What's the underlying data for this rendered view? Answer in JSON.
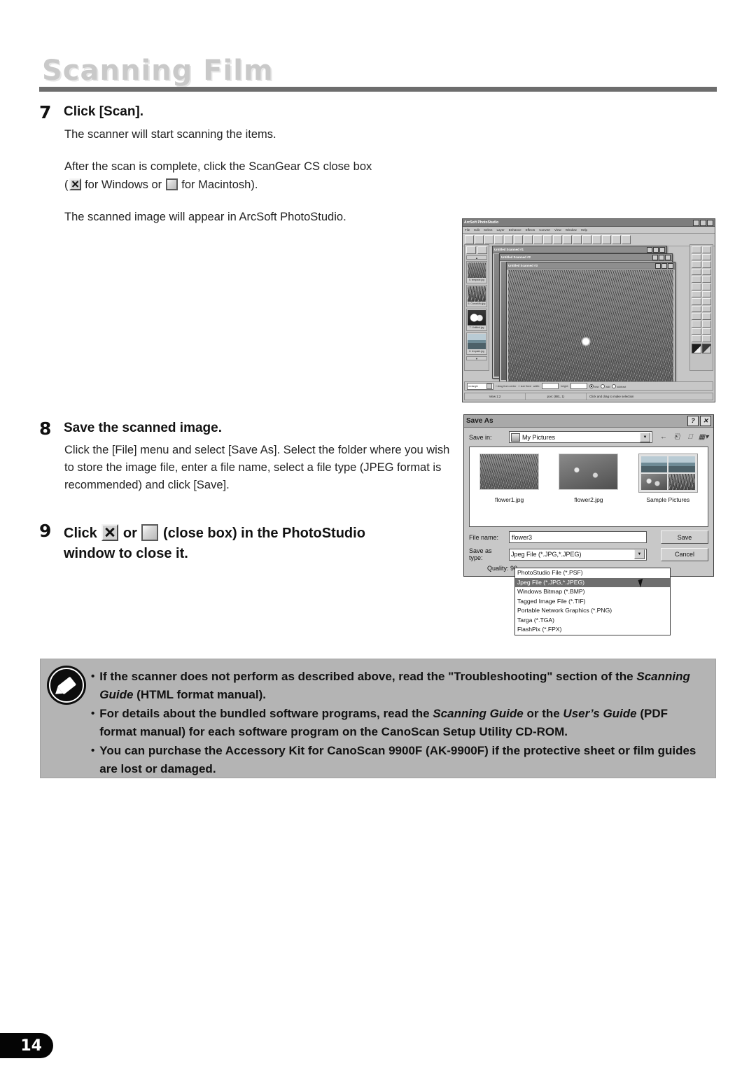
{
  "header": {
    "chapter_title": "Scanning Film"
  },
  "steps": [
    {
      "number": "7",
      "heading": "Click [Scan].",
      "line1": "The scanner will start scanning the items.",
      "line2": "After the scan is complete, click the ScanGear CS close box",
      "line3_open": "(",
      "line3_mid": " for Windows or ",
      "line3_end": " for Macintosh).",
      "line4": "The scanned image will appear in ArcSoft PhotoStudio."
    },
    {
      "number": "8",
      "heading": "Save the scanned image.",
      "body": "Click the [File] menu and select [Save As]. Select the folder where you wish to store the image file, enter a file name, select a file type (JPEG format is recommended) and click [Save]."
    },
    {
      "number": "9",
      "heading_a": "Click ",
      "heading_b": " or ",
      "heading_c": " (close box) in the PhotoStudio",
      "heading_d": "window to close it."
    }
  ],
  "photostudio": {
    "app_title": "ArcSoft PhotoStudio",
    "menus": [
      "File",
      "Edit",
      "Select",
      "Layer",
      "Enhance",
      "Effects",
      "Convert",
      "View",
      "Window",
      "Help"
    ],
    "album_thumbs": [
      {
        "caption": "5. tempwie.jpg"
      },
      {
        "caption": "6. CanonMio.jpg"
      },
      {
        "caption": "7. Untitled.jpg"
      },
      {
        "caption": "8. tenpaint.jpg"
      }
    ],
    "doc_windows": [
      {
        "title": "Untitled Scanned #1"
      },
      {
        "title": "Untitled Scanned #2"
      },
      {
        "title": "Untitled Scanned #3"
      }
    ],
    "option_bar": {
      "shape": "rectangle",
      "opt1": "drag from center",
      "opt2": "size fixed",
      "width_label": "width:",
      "height_label": "height:",
      "radio_new": "new",
      "radio_add": "add",
      "radio_subtract": "subtract"
    },
    "status": {
      "view": "View 1:2",
      "pos": "pos: (881, 1)",
      "hint": "Click and drag to make selection"
    }
  },
  "save_as": {
    "title": "Save As",
    "help_glyph": "?",
    "close_glyph": "✕",
    "save_in_label": "Save in:",
    "save_in_value": "My Pictures",
    "nav_icons": [
      "back-arrow-icon",
      "up-one-level-icon",
      "new-folder-icon",
      "views-icon"
    ],
    "files": [
      {
        "name": "flower1.jpg",
        "type": "image"
      },
      {
        "name": "flower2.jpg",
        "type": "image"
      },
      {
        "name": "Sample Pictures",
        "type": "folder"
      }
    ],
    "file_name_label": "File name:",
    "file_name_value": "flower3",
    "save_as_type_label": "Save as type:",
    "save_as_type_value": "Jpeg File (*.JPG,*.JPEG)",
    "quality_label": "Quality: 90",
    "save_button": "Save",
    "cancel_button": "Cancel",
    "type_options": [
      "PhotoStudio File (*.PSF)",
      "Jpeg File (*.JPG,*.JPEG)",
      "Windows Bitmap (*.BMP)",
      "Tagged Image File (*.TIF)",
      "Portable Network Graphics (*.PNG)",
      "Targa (*.TGA)",
      "FlashPix (*.FPX)"
    ],
    "selected_option_index": 1
  },
  "notes": [
    {
      "p1": "If the scanner does not perform as described above, read the \"Troubleshooting\" section of the ",
      "em1": "Scanning Guide",
      "p2": " (HTML format manual)."
    },
    {
      "p1": "For details about the bundled software programs, read the ",
      "em1": "Scanning Guide",
      "p2": " or the ",
      "em2": "User’s Guide",
      "p3": " (PDF format manual) for each software program on the CanoScan Setup Utility CD-ROM."
    },
    {
      "p1": "You can purchase the Accessory Kit for CanoScan 9900F (AK-9900F) if the protective sheet or film guides are lost or damaged."
    }
  ],
  "footer": {
    "page_number": "14"
  }
}
